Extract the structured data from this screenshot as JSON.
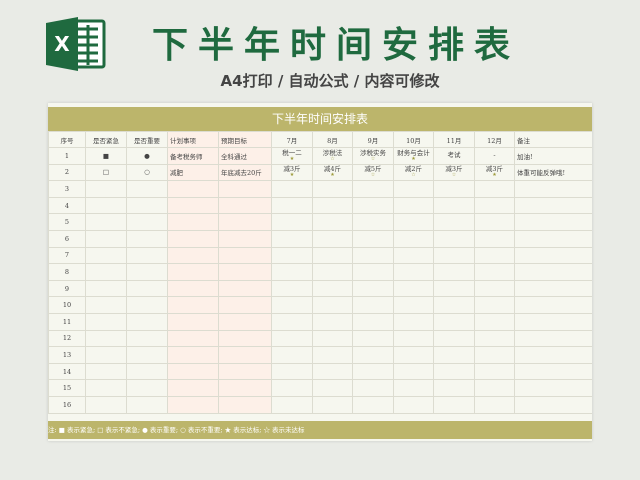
{
  "header": {
    "title": "下半年时间安排表",
    "subtitle": "A4打印 / 自动公式 / 内容可修改"
  },
  "sheet": {
    "title": "下半年时间安排表",
    "columns": [
      "序号",
      "是否紧急",
      "是否重要",
      "计划事项",
      "预期目标",
      "7月",
      "8月",
      "9月",
      "10月",
      "11月",
      "12月",
      "备注"
    ],
    "rows": [
      {
        "num": "1",
        "urgent": "■",
        "important": "●",
        "item": "备考税务师",
        "goal": "全科通过",
        "months": [
          {
            "text": "税一二",
            "star": "★"
          },
          {
            "text": "涉税法",
            "star": "☆"
          },
          {
            "text": "涉税实务",
            "star": "☆"
          },
          {
            "text": "财务与会计",
            "star": "★"
          },
          {
            "text": "考试",
            "star": ""
          },
          {
            "text": "-",
            "star": ""
          }
        ],
        "note": "加油!"
      },
      {
        "num": "2",
        "urgent": "□",
        "important": "○",
        "item": "减肥",
        "goal": "年底减去20斤",
        "months": [
          {
            "text": "减3斤",
            "star": "★"
          },
          {
            "text": "减4斤",
            "star": "★"
          },
          {
            "text": "减5斤",
            "star": "☆"
          },
          {
            "text": "减2斤",
            "star": "☆"
          },
          {
            "text": "减3斤",
            "star": "☆"
          },
          {
            "text": "减3斤",
            "star": "★"
          }
        ],
        "note": "体重可能反弹哦!"
      }
    ],
    "empty_rows": [
      "3",
      "4",
      "5",
      "6",
      "7",
      "8",
      "9",
      "10",
      "11",
      "12",
      "13",
      "14",
      "15",
      "16"
    ],
    "legend": "注:  ■  表示紧急;  □  表示不紧急;  ●  表示重要;  ○  表示不重要;  ★  表示达标;  ☆  表示未达标"
  },
  "colors": {
    "brand_green": "#1f6a3f",
    "header_gold": "#bcb56b",
    "tint": "#fdf0e8"
  },
  "icons": {
    "logo": "excel-icon"
  }
}
